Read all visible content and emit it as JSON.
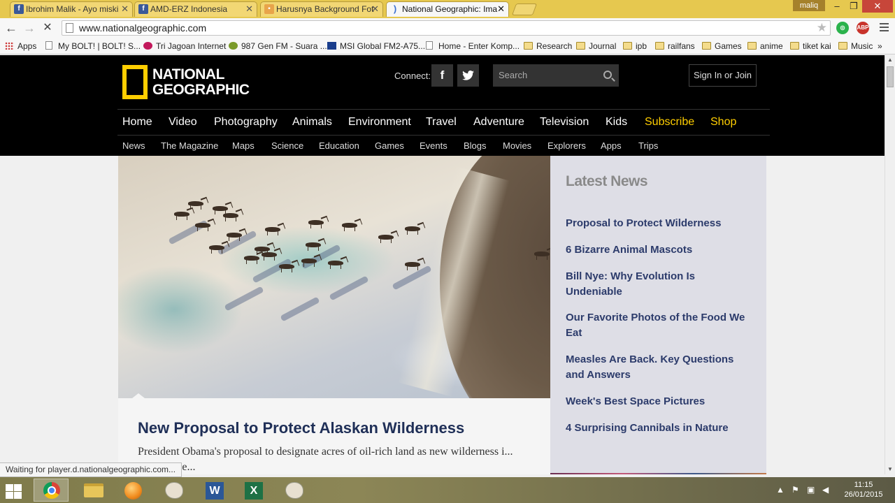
{
  "browser": {
    "tabs": [
      {
        "title": "Ibrohim Malik - Ayo miski",
        "favicon": "facebook-icon"
      },
      {
        "title": "AMD-ERZ Indonesia",
        "favicon": "facebook-icon"
      },
      {
        "title": "Harusnya Background Fot",
        "favicon": "image-icon"
      },
      {
        "title": "National Geographic: Ima",
        "favicon": "loading-icon"
      }
    ],
    "user": "maliq",
    "url": "www.nationalgeographic.com",
    "bookmarks": [
      {
        "label": "Apps",
        "icon": "apps-grid-icon"
      },
      {
        "label": "My BOLT! | BOLT! S...",
        "icon": "page-icon"
      },
      {
        "label": "Tri Jagoan Internet",
        "icon": "tri-icon"
      },
      {
        "label": "987 Gen FM - Suara ...",
        "icon": "radio-icon"
      },
      {
        "label": "MSI Global FM2-A75...",
        "icon": "msi-icon"
      },
      {
        "label": "Home - Enter Komp...",
        "icon": "page-icon"
      },
      {
        "label": "Research",
        "icon": "folder-icon"
      },
      {
        "label": "Journal",
        "icon": "folder-icon"
      },
      {
        "label": "ipb",
        "icon": "folder-icon"
      },
      {
        "label": "railfans",
        "icon": "folder-icon"
      },
      {
        "label": "Games",
        "icon": "folder-icon"
      },
      {
        "label": "anime",
        "icon": "folder-icon"
      },
      {
        "label": "tiket kai",
        "icon": "folder-icon"
      },
      {
        "label": "Music",
        "icon": "folder-icon"
      }
    ],
    "overflow": "»",
    "status": "Waiting for player.d.nationalgeographic.com..."
  },
  "site": {
    "logo_line1": "NATIONAL",
    "logo_line2": "GEOGRAPHIC",
    "connect_label": "Connect:",
    "facebook": "f",
    "search_placeholder": "Search",
    "signin": "Sign In or Join",
    "main_nav": [
      "Home",
      "Video",
      "Photography",
      "Animals",
      "Environment",
      "Travel",
      "Adventure",
      "Television",
      "Kids",
      "Subscribe",
      "Shop"
    ],
    "sub_nav": [
      "News",
      "The Magazine",
      "Maps",
      "Science",
      "Education",
      "Games",
      "Events",
      "Blogs",
      "Movies",
      "Explorers",
      "Apps",
      "Trips"
    ],
    "accent_color": "#ffce00",
    "headline": "New Proposal to Protect Alaskan Wilderness",
    "teaser": "President Obama's proposal to designate acres of oil-rich land as new wilderness i... likely... ...e...",
    "latest_title": "Latest News",
    "latest_links": [
      "Proposal to Protect Wilderness",
      "6 Bizarre Animal Mascots",
      "Bill Nye: Why Evolution Is Undeniable",
      "Our Favorite Photos of the Food We Eat",
      "Measles Are Back. Key Questions and Answers",
      "Week's Best Space Pictures",
      "4 Surprising Cannibals in Nature"
    ]
  },
  "taskbar": {
    "time": "11:15",
    "date": "26/01/2015"
  }
}
